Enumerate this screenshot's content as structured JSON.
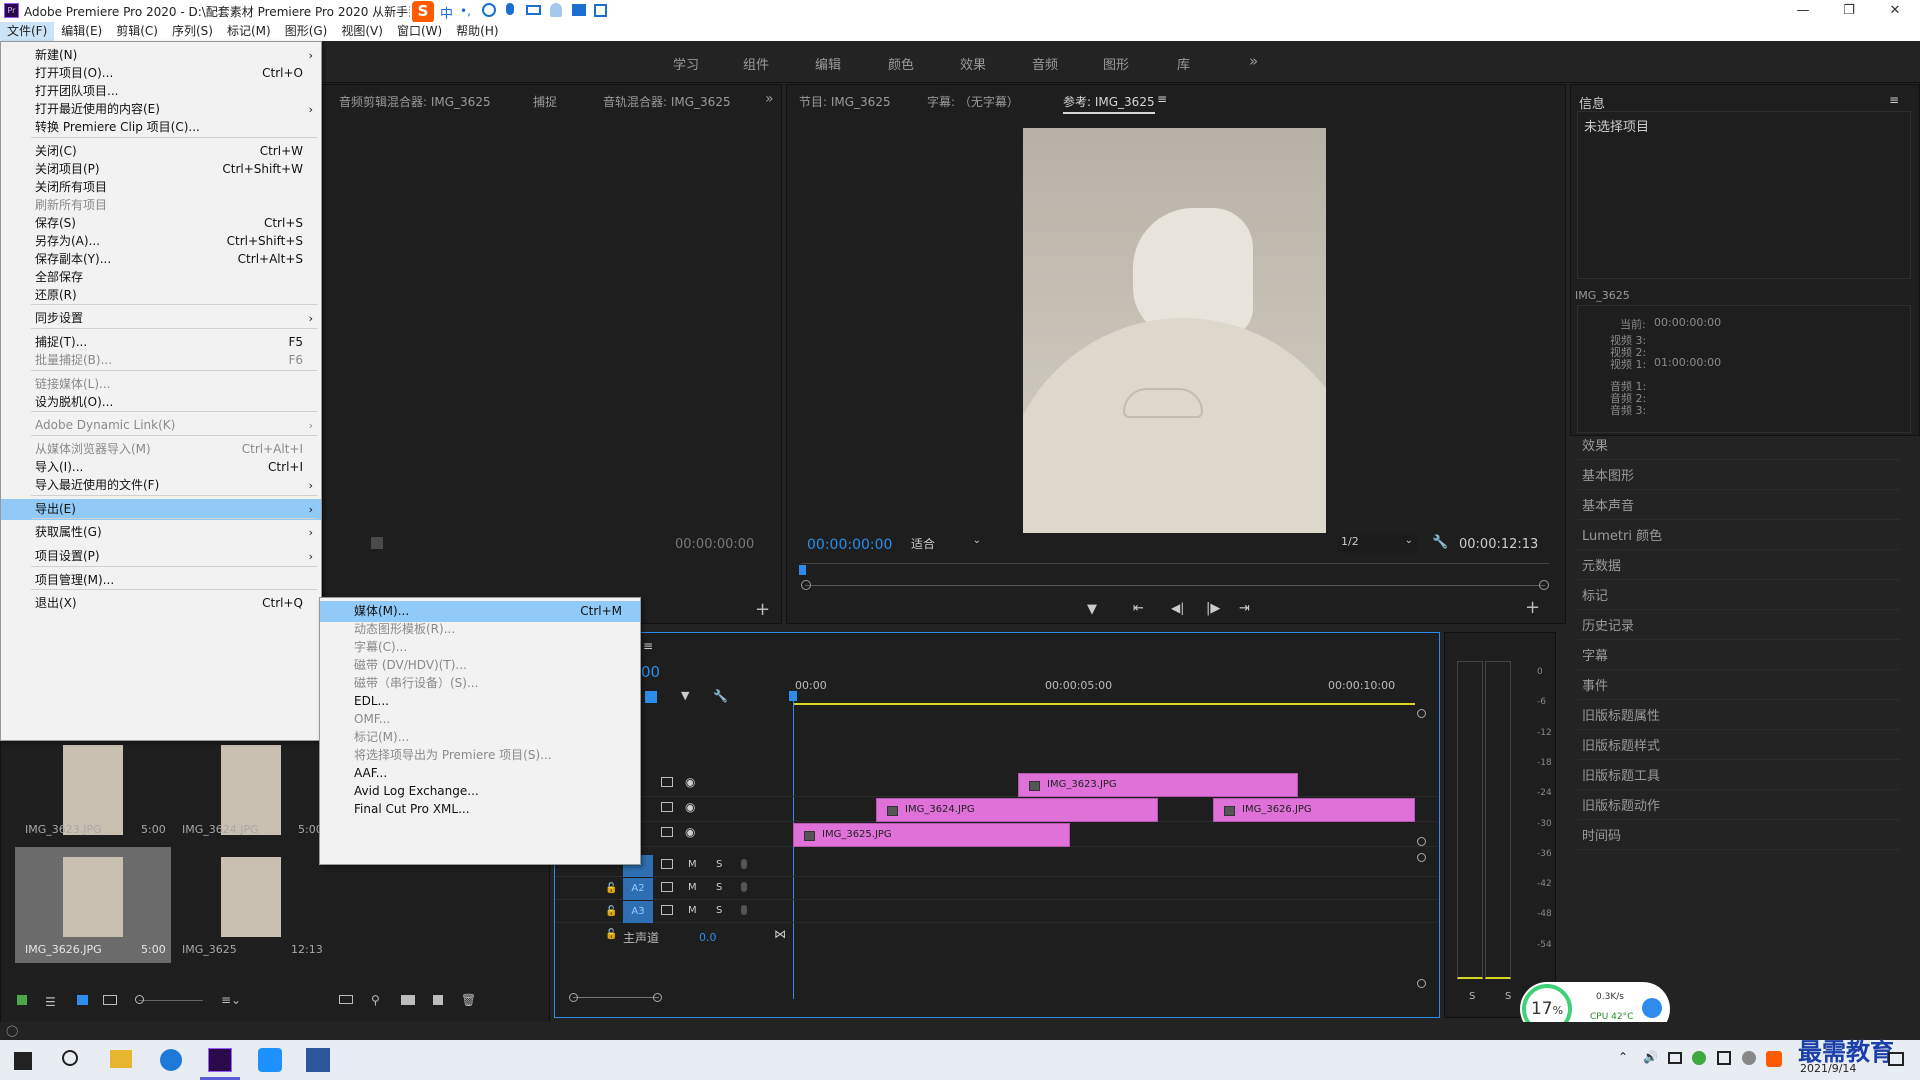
{
  "titlebar": {
    "title": "Adobe Premiere Pro 2020 - D:\\配套素材 Premiere Pro 2020 从新手到高手\\第2章\\2.5.3\\素材\\未命名 *",
    "ime_label": "中"
  },
  "menubar": [
    "文件(F)",
    "编辑(E)",
    "剪辑(C)",
    "序列(S)",
    "标记(M)",
    "图形(G)",
    "视图(V)",
    "窗口(W)",
    "帮助(H)"
  ],
  "workspaces": [
    "学习",
    "组件",
    "编辑",
    "颜色",
    "效果",
    "音频",
    "图形",
    "库"
  ],
  "file_menu": [
    {
      "label": "新建(N)",
      "shortcut": "",
      "arrow": true,
      "disabled": false
    },
    {
      "label": "打开项目(O)...",
      "shortcut": "Ctrl+O",
      "arrow": false,
      "disabled": false
    },
    {
      "label": "打开团队项目...",
      "shortcut": "",
      "arrow": false,
      "disabled": false
    },
    {
      "label": "打开最近使用的内容(E)",
      "shortcut": "",
      "arrow": true,
      "disabled": false
    },
    {
      "label": "转换 Premiere Clip 项目(C)...",
      "shortcut": "",
      "arrow": false,
      "disabled": false
    },
    {
      "label": "关闭(C)",
      "shortcut": "Ctrl+W",
      "arrow": false,
      "disabled": false
    },
    {
      "label": "关闭项目(P)",
      "shortcut": "Ctrl+Shift+W",
      "arrow": false,
      "disabled": false
    },
    {
      "label": "关闭所有项目",
      "shortcut": "",
      "arrow": false,
      "disabled": false
    },
    {
      "label": "刷新所有项目",
      "shortcut": "",
      "arrow": false,
      "disabled": true
    },
    {
      "label": "保存(S)",
      "shortcut": "Ctrl+S",
      "arrow": false,
      "disabled": false
    },
    {
      "label": "另存为(A)...",
      "shortcut": "Ctrl+Shift+S",
      "arrow": false,
      "disabled": false
    },
    {
      "label": "保存副本(Y)...",
      "shortcut": "Ctrl+Alt+S",
      "arrow": false,
      "disabled": false
    },
    {
      "label": "全部保存",
      "shortcut": "",
      "arrow": false,
      "disabled": false
    },
    {
      "label": "还原(R)",
      "shortcut": "",
      "arrow": false,
      "disabled": false
    },
    {
      "label": "同步设置",
      "shortcut": "",
      "arrow": true,
      "disabled": false
    },
    {
      "label": "捕捉(T)...",
      "shortcut": "F5",
      "arrow": false,
      "disabled": false
    },
    {
      "label": "批量捕捉(B)...",
      "shortcut": "F6",
      "arrow": false,
      "disabled": true
    },
    {
      "label": "链接媒体(L)...",
      "shortcut": "",
      "arrow": false,
      "disabled": true
    },
    {
      "label": "设为脱机(O)...",
      "shortcut": "",
      "arrow": false,
      "disabled": false
    },
    {
      "label": "Adobe Dynamic Link(K)",
      "shortcut": "",
      "arrow": true,
      "disabled": true
    },
    {
      "label": "从媒体浏览器导入(M)",
      "shortcut": "Ctrl+Alt+I",
      "arrow": false,
      "disabled": true
    },
    {
      "label": "导入(I)...",
      "shortcut": "Ctrl+I",
      "arrow": false,
      "disabled": false
    },
    {
      "label": "导入最近使用的文件(F)",
      "shortcut": "",
      "arrow": true,
      "disabled": false
    },
    {
      "label": "导出(E)",
      "shortcut": "",
      "arrow": true,
      "disabled": false,
      "highlighted": true
    },
    {
      "label": "获取属性(G)",
      "shortcut": "",
      "arrow": true,
      "disabled": false
    },
    {
      "label": "项目设置(P)",
      "shortcut": "",
      "arrow": true,
      "disabled": false
    },
    {
      "label": "项目管理(M)...",
      "shortcut": "",
      "arrow": false,
      "disabled": false
    },
    {
      "label": "退出(X)",
      "shortcut": "Ctrl+Q",
      "arrow": false,
      "disabled": false
    }
  ],
  "export_menu": [
    {
      "label": "媒体(M)...",
      "shortcut": "Ctrl+M",
      "disabled": false,
      "highlighted": true
    },
    {
      "label": "动态图形模板(R)...",
      "shortcut": "",
      "disabled": true
    },
    {
      "label": "字幕(C)...",
      "shortcut": "",
      "disabled": true
    },
    {
      "label": "磁带 (DV/HDV)(T)...",
      "shortcut": "",
      "disabled": true
    },
    {
      "label": "磁带（串行设备）(S)...",
      "shortcut": "",
      "disabled": true
    },
    {
      "label": "EDL...",
      "shortcut": "",
      "disabled": false
    },
    {
      "label": "OMF...",
      "shortcut": "",
      "disabled": true
    },
    {
      "label": "标记(M)...",
      "shortcut": "",
      "disabled": true
    },
    {
      "label": "将选择项导出为 Premiere 项目(S)...",
      "shortcut": "",
      "disabled": true
    },
    {
      "label": "AAF...",
      "shortcut": "",
      "disabled": false
    },
    {
      "label": "Avid Log Exchange...",
      "shortcut": "",
      "disabled": false
    },
    {
      "label": "Final Cut Pro XML...",
      "shortcut": "",
      "disabled": false
    }
  ],
  "source_panel": {
    "tabs": [
      "音频剪辑混合器: IMG_3625",
      "捕捉",
      "音轨混合器: IMG_3625"
    ],
    "timecode": "00:00:00:00"
  },
  "program_panel": {
    "tabs": [
      "节目: IMG_3625",
      "字幕: （无字幕）",
      "参考: IMG_3625"
    ],
    "timecode_left": "00:00:00:00",
    "fit": "适合",
    "resolution": "1/2",
    "timecode_right": "00:00:12:13"
  },
  "info_panel": {
    "title": "信息",
    "status": "未选择项目",
    "clip_name": "IMG_3625",
    "current_label": "当前:",
    "current_value": "00:00:00:00",
    "video_tracks": [
      {
        "label": "视频 3:",
        "value": ""
      },
      {
        "label": "视频 2:",
        "value": ""
      },
      {
        "label": "视频 1:",
        "value": "01:00:00:00"
      }
    ],
    "audio_tracks": [
      "音频 1:",
      "音频 2:",
      "音频 3:"
    ]
  },
  "right_panels": [
    "效果",
    "基本图形",
    "基本声音",
    "Lumetri 颜色",
    "元数据",
    "标记",
    "历史记录",
    "字幕",
    "事件",
    "旧版标题属性",
    "旧版标题样式",
    "旧版标题工具",
    "旧版标题动作",
    "时间码"
  ],
  "project_items": [
    {
      "name": "IMG_3623.JPG",
      "duration": "5:00"
    },
    {
      "name": "IMG_3624.JPG",
      "duration": "5:00"
    },
    {
      "name": "IMG_3626.JPG",
      "duration": "5:00"
    },
    {
      "name": "IMG_3625",
      "duration": "12:13"
    }
  ],
  "timeline": {
    "timecode_partial": "00",
    "ruler": [
      "00:00",
      "00:00:05:00",
      "00:00:10:00"
    ],
    "clips": [
      {
        "name": "IMG_3623.JPG"
      },
      {
        "name": "IMG_3624.JPG"
      },
      {
        "name": "IMG_3626.JPG"
      },
      {
        "name": "IMG_3625.JPG"
      }
    ],
    "audio_tracks": [
      "A2",
      "A3"
    ],
    "track_m": "M",
    "track_s": "S",
    "master_label": "主声道",
    "master_value": "0.0"
  },
  "meter_scale": [
    "0",
    "-6",
    "-12",
    "-18",
    "-24",
    "-30",
    "-36",
    "-42",
    "-48",
    "-54"
  ],
  "meter_solo": [
    "S",
    "S"
  ],
  "perf_widget": {
    "percent": "17",
    "percent_unit": "%",
    "speed": "0.3K/s",
    "cpu": "CPU 42°C"
  },
  "taskbar": {
    "date": "2021/9/14",
    "watermark": "最需教育"
  },
  "colors": {
    "accent": "#2d8ceb",
    "clip": "#e071d9",
    "highlight": "#91c9f7"
  }
}
